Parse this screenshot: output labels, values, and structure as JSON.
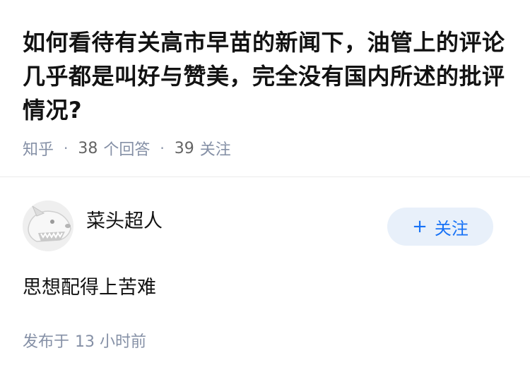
{
  "question": {
    "title": "如何看待有关高市早苗的新闻下，油管上的评论几乎都是叫好与赞美，完全没有国内所述的批评情况?",
    "source": "知乎",
    "answer_count": "38",
    "answer_label": "个回答",
    "follower_count": "39",
    "follower_label": "关注",
    "separator": "·"
  },
  "answer": {
    "author_name": "菜头超人",
    "avatar_icon": "dog-avatar-icon",
    "follow_button": {
      "plus": "+",
      "label": "关注"
    },
    "content": "思想配得上苦难",
    "time_prefix": "发布于",
    "time_value": "13 小时前"
  },
  "colors": {
    "text": "#121212",
    "meta": "#8590a6",
    "accent": "#1772f6",
    "button_bg": "#e8f0fa"
  }
}
